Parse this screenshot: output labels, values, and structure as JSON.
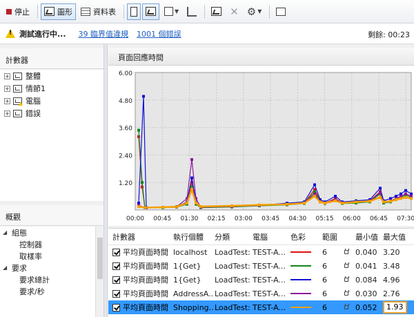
{
  "toolbar": {
    "stop_label": "停止",
    "graph_label": "圖形",
    "table_label": "資料表"
  },
  "status": {
    "running": "測試進行中...",
    "threshold_link": "39 臨界值違規",
    "error_link": "1001 個錯誤",
    "remaining": "剩餘: 00:23"
  },
  "counters_panel": {
    "title": "計數器",
    "items": [
      {
        "label": "整體",
        "warned": false
      },
      {
        "label": "情節1",
        "warned": false
      },
      {
        "label": "電腦",
        "warned": true
      },
      {
        "label": "錯誤",
        "warned": false
      }
    ]
  },
  "overview_panel": {
    "title": "概觀",
    "items": [
      {
        "label": "組態",
        "kind": "group",
        "expander": "◢"
      },
      {
        "label": "控制器",
        "kind": "sub"
      },
      {
        "label": "取樣率",
        "kind": "sub"
      },
      {
        "label": "要求",
        "kind": "group",
        "expander": "◢"
      },
      {
        "label": "要求總計",
        "kind": "sub"
      },
      {
        "label": "要求/秒",
        "kind": "sub"
      }
    ]
  },
  "graph": {
    "title": "頁面回應時間"
  },
  "legend": {
    "headers": {
      "counter": "計數器",
      "instance": "執行個體",
      "category": "分類",
      "computer": "電腦",
      "color": "色彩",
      "range": "範圍",
      "min": "最小值",
      "max": "最大值"
    },
    "rows": [
      {
        "counter": "平均頁面時間",
        "instance": "localhost",
        "category": "LoadTest:",
        "computer": "TEST-A...",
        "color": "#e01010",
        "range": "6",
        "min": "0.040",
        "max": "3.20",
        "selected": false
      },
      {
        "counter": "平均頁面時間",
        "instance": "1{Get}",
        "category": "LoadTest:",
        "computer": "TEST-A...",
        "color": "#10881a",
        "range": "6",
        "min": "0.041",
        "max": "3.48",
        "selected": false
      },
      {
        "counter": "平均頁面時間",
        "instance": "1{Get}",
        "category": "LoadTest:",
        "computer": "TEST-A...",
        "color": "#1010d8",
        "range": "6",
        "min": "0.084",
        "max": "4.96",
        "selected": false
      },
      {
        "counter": "平均頁面時間",
        "instance": "AddressA...",
        "category": "LoadTest:",
        "computer": "TEST-A...",
        "color": "#8a1a9a",
        "range": "6",
        "min": "0.030",
        "max": "2.76",
        "selected": false
      },
      {
        "counter": "平均頁面時間",
        "instance": "Shopping...",
        "category": "LoadTest:",
        "computer": "TEST-A...",
        "color": "#f5a000",
        "range": "6",
        "min": "0.052",
        "max": "1.93",
        "selected": true
      }
    ]
  },
  "chart_data": {
    "type": "line",
    "ylim": [
      0,
      6
    ],
    "yticks": [
      "6.00",
      "4.80",
      "3.60",
      "2.40",
      "1.20"
    ],
    "xticks": [
      "00:00",
      "00:45",
      "01:30",
      "02:15",
      "03:00",
      "03:45",
      "04:30",
      "05:15",
      "06:00",
      "06:45",
      "07:30"
    ],
    "series": [
      {
        "color": "#e01010",
        "points": [
          [
            5,
            3.2
          ],
          [
            10,
            1.0
          ],
          [
            14,
            0.1
          ],
          [
            40,
            0.12
          ],
          [
            60,
            0.15
          ],
          [
            75,
            0.3
          ],
          [
            82,
            1.2
          ],
          [
            88,
            0.3
          ],
          [
            95,
            0.12
          ],
          [
            140,
            0.15
          ],
          [
            180,
            0.2
          ],
          [
            220,
            0.25
          ],
          [
            245,
            0.3
          ],
          [
            260,
            0.9
          ],
          [
            268,
            0.4
          ],
          [
            275,
            0.3
          ],
          [
            290,
            0.5
          ],
          [
            300,
            0.3
          ],
          [
            320,
            0.35
          ],
          [
            340,
            0.4
          ],
          [
            355,
            0.8
          ],
          [
            360,
            0.35
          ],
          [
            370,
            0.4
          ],
          [
            378,
            0.5
          ],
          [
            385,
            0.6
          ],
          [
            392,
            0.7
          ],
          [
            400,
            0.6
          ]
        ]
      },
      {
        "color": "#10881a",
        "points": [
          [
            5,
            3.48
          ],
          [
            10,
            1.2
          ],
          [
            14,
            0.1
          ],
          [
            40,
            0.1
          ],
          [
            60,
            0.12
          ],
          [
            75,
            0.25
          ],
          [
            82,
            1.0
          ],
          [
            88,
            0.25
          ],
          [
            95,
            0.1
          ],
          [
            140,
            0.13
          ],
          [
            180,
            0.18
          ],
          [
            220,
            0.22
          ],
          [
            245,
            0.28
          ],
          [
            260,
            0.8
          ],
          [
            268,
            0.35
          ],
          [
            275,
            0.28
          ],
          [
            290,
            0.45
          ],
          [
            300,
            0.28
          ],
          [
            320,
            0.3
          ],
          [
            340,
            0.35
          ],
          [
            355,
            0.7
          ],
          [
            360,
            0.3
          ],
          [
            370,
            0.35
          ],
          [
            378,
            0.45
          ],
          [
            385,
            0.55
          ],
          [
            392,
            0.65
          ],
          [
            400,
            0.55
          ]
        ]
      },
      {
        "color": "#1010d8",
        "points": [
          [
            5,
            0.3
          ],
          [
            12,
            4.96
          ],
          [
            16,
            0.1
          ],
          [
            40,
            0.12
          ],
          [
            60,
            0.14
          ],
          [
            75,
            0.35
          ],
          [
            82,
            1.4
          ],
          [
            88,
            0.35
          ],
          [
            95,
            0.12
          ],
          [
            140,
            0.16
          ],
          [
            180,
            0.2
          ],
          [
            220,
            0.3
          ],
          [
            245,
            0.35
          ],
          [
            260,
            1.1
          ],
          [
            268,
            0.45
          ],
          [
            275,
            0.35
          ],
          [
            290,
            0.6
          ],
          [
            300,
            0.35
          ],
          [
            320,
            0.4
          ],
          [
            340,
            0.45
          ],
          [
            355,
            0.95
          ],
          [
            360,
            0.4
          ],
          [
            370,
            0.5
          ],
          [
            378,
            0.6
          ],
          [
            385,
            0.7
          ],
          [
            392,
            0.85
          ],
          [
            400,
            0.7
          ]
        ]
      },
      {
        "color": "#8a1a9a",
        "points": [
          [
            5,
            0.2
          ],
          [
            14,
            0.1
          ],
          [
            40,
            0.12
          ],
          [
            60,
            0.14
          ],
          [
            75,
            0.5
          ],
          [
            82,
            2.2
          ],
          [
            88,
            0.5
          ],
          [
            95,
            0.12
          ],
          [
            140,
            0.15
          ],
          [
            180,
            0.2
          ],
          [
            220,
            0.25
          ],
          [
            245,
            0.3
          ],
          [
            260,
            0.7
          ],
          [
            268,
            0.35
          ],
          [
            275,
            0.3
          ],
          [
            290,
            0.45
          ],
          [
            300,
            0.3
          ],
          [
            320,
            0.35
          ],
          [
            340,
            0.4
          ],
          [
            355,
            0.75
          ],
          [
            360,
            0.35
          ],
          [
            370,
            0.4
          ],
          [
            378,
            0.5
          ],
          [
            385,
            0.6
          ],
          [
            392,
            0.7
          ],
          [
            400,
            0.6
          ]
        ]
      },
      {
        "color": "#f5a000",
        "points": [
          [
            5,
            0.15
          ],
          [
            14,
            0.1
          ],
          [
            40,
            0.12
          ],
          [
            60,
            0.14
          ],
          [
            75,
            0.3
          ],
          [
            82,
            0.9
          ],
          [
            88,
            0.3
          ],
          [
            95,
            0.15
          ],
          [
            140,
            0.18
          ],
          [
            180,
            0.22
          ],
          [
            220,
            0.25
          ],
          [
            245,
            0.3
          ],
          [
            260,
            0.6
          ],
          [
            268,
            0.35
          ],
          [
            275,
            0.3
          ],
          [
            290,
            0.4
          ],
          [
            300,
            0.3
          ],
          [
            320,
            0.35
          ],
          [
            340,
            0.38
          ],
          [
            355,
            0.55
          ],
          [
            360,
            0.35
          ],
          [
            370,
            0.38
          ],
          [
            378,
            0.45
          ],
          [
            385,
            0.5
          ],
          [
            392,
            0.55
          ],
          [
            400,
            0.5
          ]
        ]
      }
    ]
  }
}
